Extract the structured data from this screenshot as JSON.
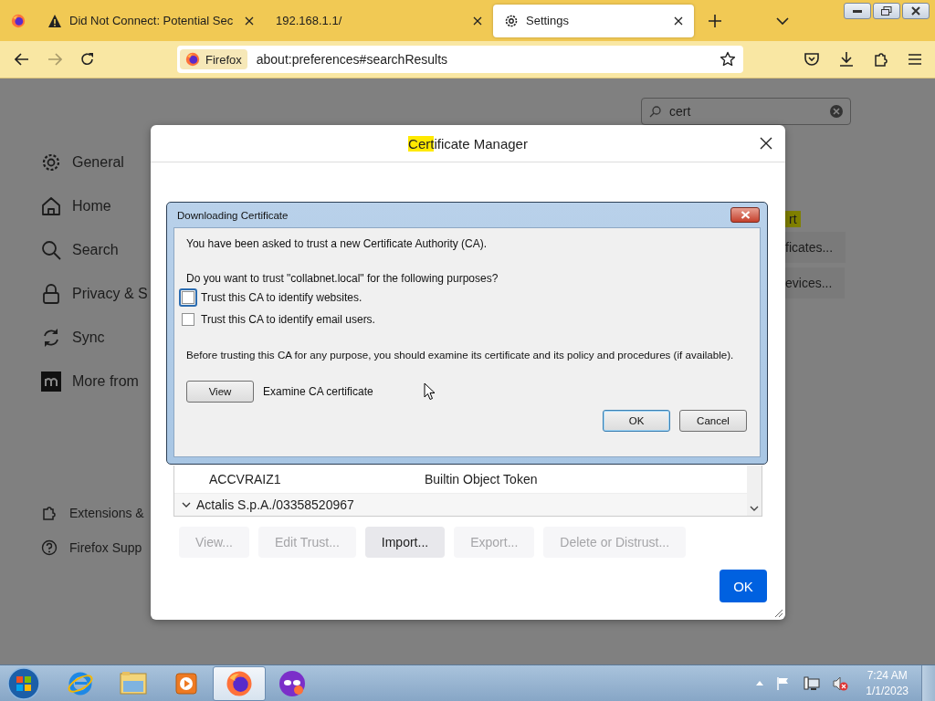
{
  "browser_tabs": [
    {
      "kind": "pinned",
      "selected": false
    },
    {
      "kind": "warning",
      "title": "Did Not Connect: Potential Sec",
      "selected": false
    },
    {
      "kind": "plain",
      "title": "192.168.1.1/",
      "selected": false
    },
    {
      "kind": "settings",
      "title": "Settings",
      "selected": true
    }
  ],
  "toolbar": {
    "identity": "Firefox",
    "url": "about:preferences#searchResults",
    "forward_disabled": true
  },
  "settings_search": {
    "value": "cert"
  },
  "sidebar": {
    "items": [
      {
        "label": "General"
      },
      {
        "label": "Home"
      },
      {
        "label": "Search"
      },
      {
        "label": "Privacy & S"
      },
      {
        "label": "Sync"
      },
      {
        "label": "More from"
      }
    ],
    "footer_items": [
      {
        "label": "Extensions &"
      },
      {
        "label": "Firefox Supp"
      }
    ]
  },
  "background_matches": {
    "highlight": "rt",
    "buttons": [
      "ficates...",
      "evices..."
    ]
  },
  "certificate_manager": {
    "title_parts": [
      {
        "text": "Cert",
        "highlighted": true
      },
      {
        "text": "ificate Manager",
        "highlighted": false
      }
    ],
    "rows": [
      {
        "kind": "cert",
        "name": "ACCVRAIZ1",
        "device": "Builtin Object Token"
      },
      {
        "kind": "group",
        "name": "Actalis S.p.A./03358520967",
        "expanded": true
      }
    ],
    "buttons": [
      {
        "label": "View...",
        "disabled": true
      },
      {
        "label": "Edit Trust...",
        "disabled": true
      },
      {
        "label": "Import...",
        "disabled": false
      },
      {
        "label": "Export...",
        "disabled": true
      },
      {
        "label": "Delete or Distrust...",
        "disabled": true
      }
    ],
    "ok": "OK"
  },
  "download_dialog": {
    "title": "Downloading Certificate",
    "intro": "You have been asked to trust a new Certificate Authority (CA).",
    "question": "Do you want to trust \"collabnet.local\" for the following purposes?",
    "options": [
      {
        "label": "Trust this CA to identify websites.",
        "checked": false,
        "focused": true
      },
      {
        "label": "Trust this CA to identify email users.",
        "checked": false,
        "focused": false
      }
    ],
    "advice": "Before trusting this CA for any purpose, you should examine its certificate and its policy and procedures (if available).",
    "view_button": "View",
    "view_label": "Examine CA certificate",
    "ok": "OK",
    "cancel": "Cancel"
  },
  "taskbar": {
    "apps": [
      {
        "kind": "ie",
        "active": false
      },
      {
        "kind": "explorer",
        "active": false
      },
      {
        "kind": "media",
        "active": false
      },
      {
        "kind": "firefox",
        "active": true
      },
      {
        "kind": "mask",
        "active": false
      }
    ],
    "time": "7:24 AM",
    "date": "1/1/2023"
  }
}
